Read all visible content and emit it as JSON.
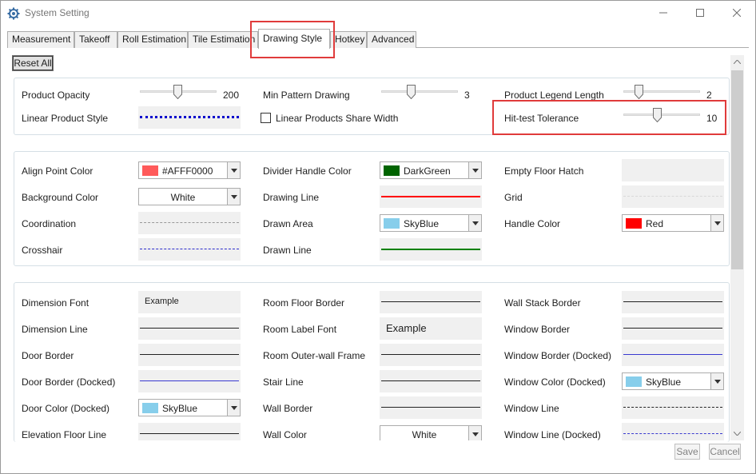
{
  "window": {
    "title": "System Setting",
    "icon": "gear-icon"
  },
  "tabs": [
    {
      "label": "Measurement",
      "active": false
    },
    {
      "label": "Takeoff",
      "active": false
    },
    {
      "label": "Roll Estimation",
      "active": false
    },
    {
      "label": "Tile Estimation",
      "active": false
    },
    {
      "label": "Drawing Style",
      "active": true
    },
    {
      "label": "Hotkey",
      "active": false
    },
    {
      "label": "Advanced",
      "active": false
    }
  ],
  "reset_all_label": "Reset All",
  "section1": {
    "product_opacity": {
      "label": "Product Opacity",
      "value": "200"
    },
    "min_pattern_drawing": {
      "label": "Min Pattern Drawing",
      "value": "3"
    },
    "product_legend_length": {
      "label": "Product Legend Length",
      "value": "2"
    },
    "linear_product_style": {
      "label": "Linear Product Style"
    },
    "linear_products_share_width": {
      "label": "Linear Products Share Width",
      "checked": false
    },
    "hit_test_tolerance": {
      "label": "Hit-test Tolerance",
      "value": "10"
    }
  },
  "section2": {
    "align_point_color": {
      "label": "Align Point Color",
      "value": "#AFFF0000",
      "swatch": "#ff5a5a"
    },
    "divider_handle_color": {
      "label": "Divider Handle Color",
      "value": "DarkGreen",
      "swatch": "#006400"
    },
    "empty_floor_hatch": {
      "label": "Empty Floor Hatch"
    },
    "background_color": {
      "label": "Background Color",
      "value": "White"
    },
    "drawing_line": {
      "label": "Drawing Line",
      "color": "#ff0000"
    },
    "grid": {
      "label": "Grid"
    },
    "coordination": {
      "label": "Coordination"
    },
    "drawn_area": {
      "label": "Drawn Area",
      "value": "SkyBlue",
      "swatch": "#87ceeb"
    },
    "handle_color": {
      "label": "Handle Color",
      "value": "Red",
      "swatch": "#ff0000"
    },
    "crosshair": {
      "label": "Crosshair"
    },
    "drawn_line": {
      "label": "Drawn Line",
      "color": "#008000"
    }
  },
  "section3": {
    "dimension_font": {
      "label": "Dimension Font",
      "example": "Example"
    },
    "room_floor_border": {
      "label": "Room Floor Border"
    },
    "wall_stack_border": {
      "label": "Wall Stack Border"
    },
    "dimension_line": {
      "label": "Dimension Line"
    },
    "room_label_font": {
      "label": "Room Label Font",
      "example": "Example"
    },
    "window_border": {
      "label": "Window Border"
    },
    "door_border": {
      "label": "Door Border"
    },
    "room_outer_wall_frame": {
      "label": "Room Outer-wall Frame"
    },
    "window_border_docked": {
      "label": "Window Border (Docked)",
      "color": "#3a3ad0"
    },
    "door_border_docked": {
      "label": "Door Border (Docked)",
      "color": "#3a3ad0"
    },
    "stair_line": {
      "label": "Stair Line"
    },
    "window_color_docked": {
      "label": "Window Color (Docked)",
      "value": "SkyBlue",
      "swatch": "#87ceeb"
    },
    "door_color_docked": {
      "label": "Door Color (Docked)",
      "value": "SkyBlue",
      "swatch": "#87ceeb"
    },
    "wall_border": {
      "label": "Wall Border"
    },
    "window_line": {
      "label": "Window Line"
    },
    "elevation_floor_line": {
      "label": "Elevation Floor Line"
    },
    "wall_color": {
      "label": "Wall Color",
      "value": "White"
    },
    "window_line_docked": {
      "label": "Window Line (Docked)",
      "color": "#3a3ad0"
    }
  },
  "buttons": {
    "save": "Save",
    "cancel": "Cancel"
  },
  "colors": {
    "highlight": "#e03b3b",
    "accent_blue": "#0000cc"
  }
}
